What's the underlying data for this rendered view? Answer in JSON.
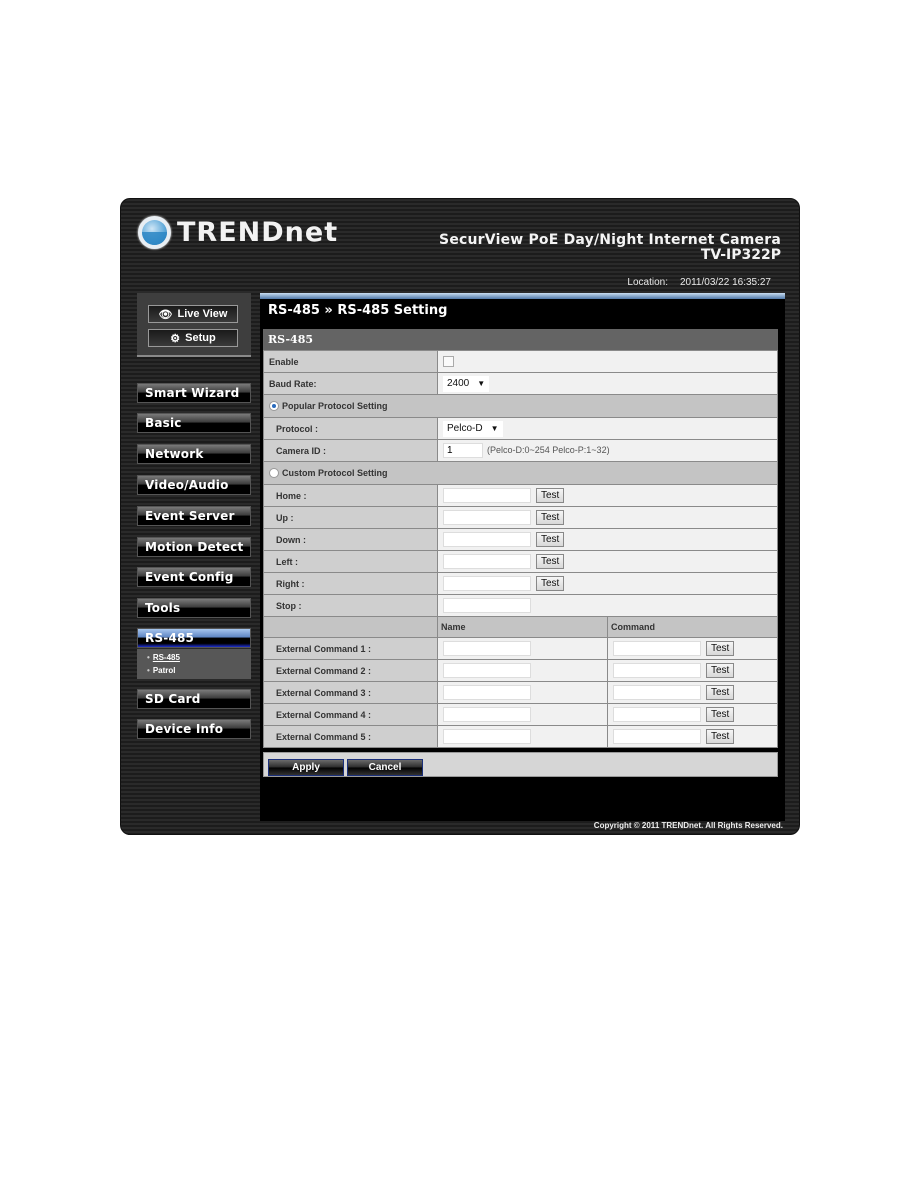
{
  "header": {
    "brand": "TRENDnet",
    "product_title": "SecurView PoE Day/Night Internet Camera",
    "model": "TV-IP322P",
    "location_label": "Location:",
    "datetime": "2011/03/22 16:35:27"
  },
  "modes": {
    "live_view": "Live View",
    "setup": "Setup"
  },
  "nav": [
    {
      "label": "Smart Wizard"
    },
    {
      "label": "Basic"
    },
    {
      "label": "Network"
    },
    {
      "label": "Video/Audio"
    },
    {
      "label": "Event Server"
    },
    {
      "label": "Motion Detect"
    },
    {
      "label": "Event Config"
    },
    {
      "label": "Tools"
    },
    {
      "label": "RS-485",
      "active": true
    },
    {
      "label": "SD Card"
    },
    {
      "label": "Device Info"
    }
  ],
  "subnav": [
    {
      "label": "RS-485",
      "current": true
    },
    {
      "label": "Patrol"
    }
  ],
  "page": {
    "title": "RS-485 » RS-485 Setting",
    "section": "RS-485",
    "enable_label": "Enable",
    "enable_checked": false,
    "baud_label": "Baud Rate:",
    "baud_value": "2400",
    "popular_label": "Popular Protocol Setting",
    "popular_selected": true,
    "protocol_label": "Protocol :",
    "protocol_value": "Pelco-D",
    "camera_id_label": "Camera ID :",
    "camera_id_value": "1",
    "camera_id_hint": "(Pelco-D:0~254 Pelco-P:1~32)",
    "custom_label": "Custom Protocol Setting",
    "custom_selected": false,
    "custom_rows": [
      {
        "label": "Home :",
        "value": "",
        "test": "Test"
      },
      {
        "label": "Up :",
        "value": "",
        "test": "Test"
      },
      {
        "label": "Down :",
        "value": "",
        "test": "Test"
      },
      {
        "label": "Left :",
        "value": "",
        "test": "Test"
      },
      {
        "label": "Right :",
        "value": "",
        "test": "Test"
      },
      {
        "label": "Stop :",
        "value": ""
      }
    ],
    "ext_headers": {
      "name": "Name",
      "command": "Command"
    },
    "ext_rows": [
      {
        "label": "External Command 1 :",
        "name": "",
        "command": "",
        "test": "Test"
      },
      {
        "label": "External Command 2 :",
        "name": "",
        "command": "",
        "test": "Test"
      },
      {
        "label": "External Command 3 :",
        "name": "",
        "command": "",
        "test": "Test"
      },
      {
        "label": "External Command 4 :",
        "name": "",
        "command": "",
        "test": "Test"
      },
      {
        "label": "External Command 5 :",
        "name": "",
        "command": "",
        "test": "Test"
      }
    ],
    "apply": "Apply",
    "cancel": "Cancel"
  },
  "footer": {
    "copyright": "Copyright © 2011 TRENDnet. All Rights Reserved."
  }
}
